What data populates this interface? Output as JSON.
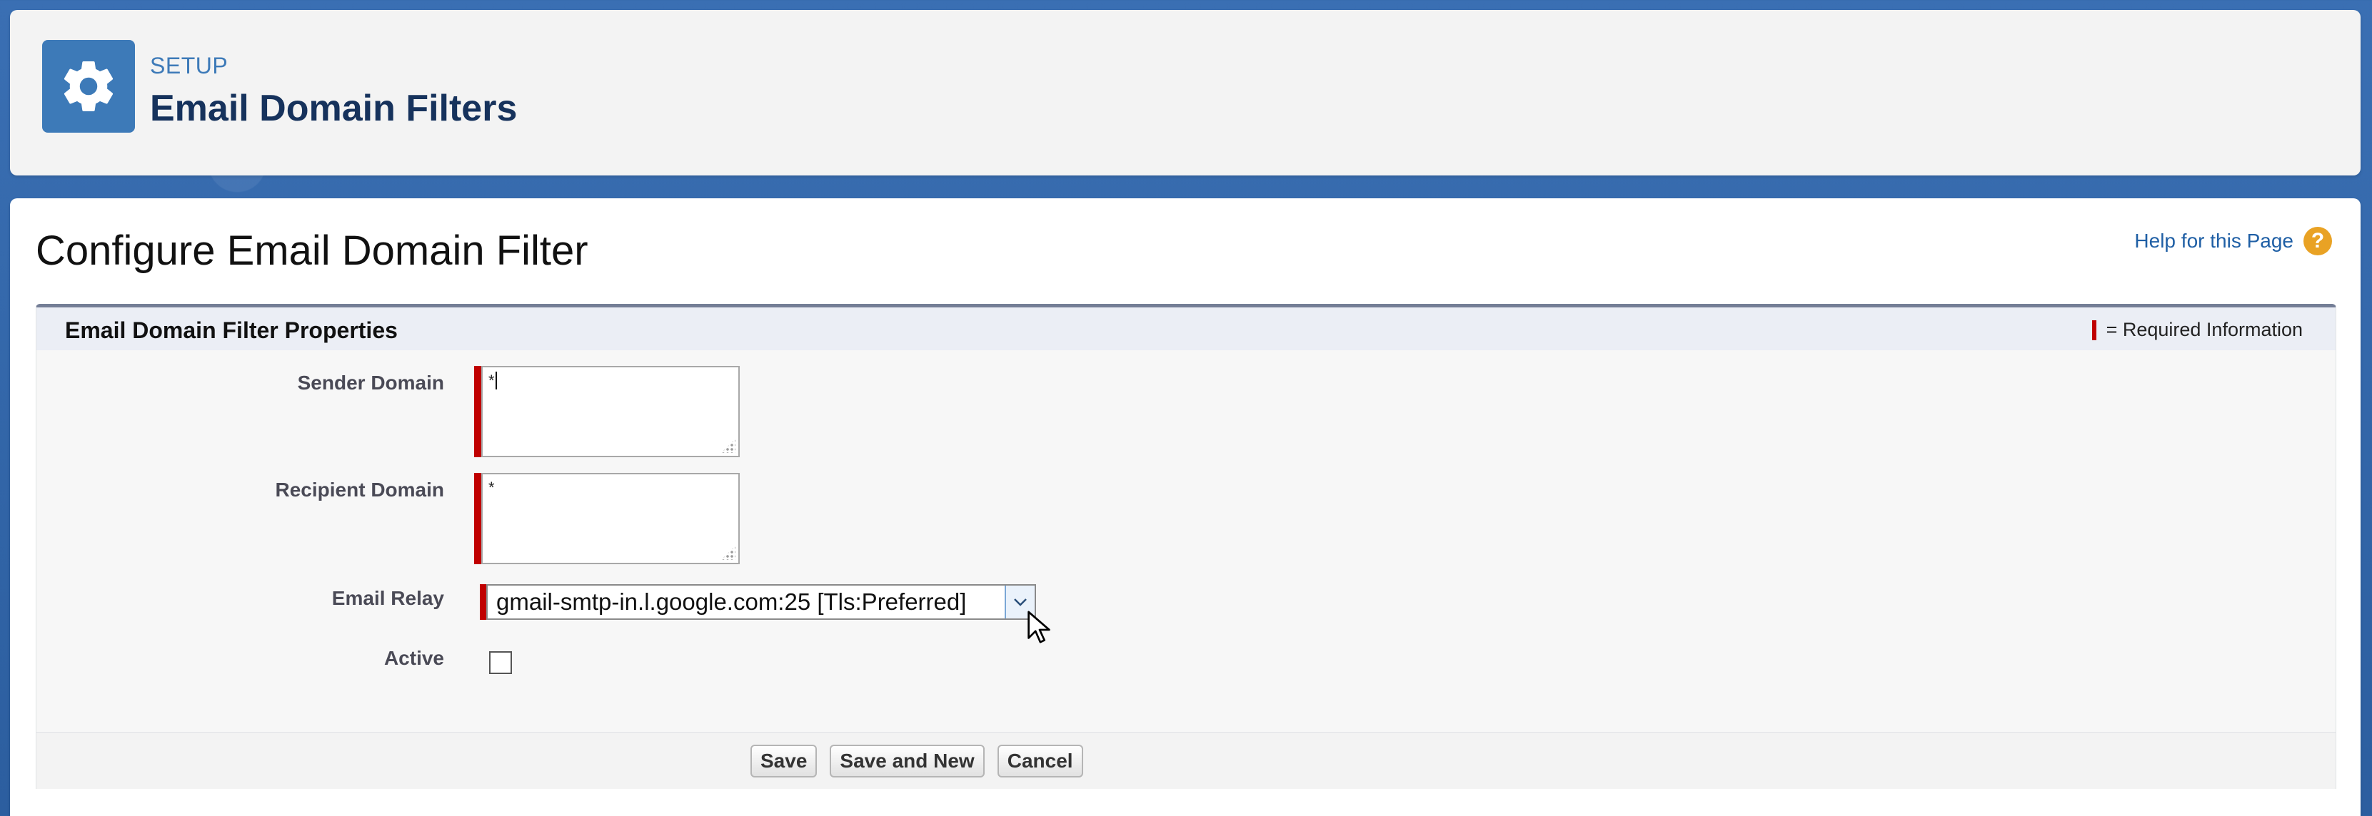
{
  "header": {
    "eyebrow": "SETUP",
    "title": "Email Domain Filters",
    "icon": "gear-icon"
  },
  "page": {
    "title": "Configure Email Domain Filter",
    "help_link": "Help for this Page",
    "help_icon": "question-circle-icon"
  },
  "section": {
    "title": "Email Domain Filter Properties",
    "required_legend": "= Required Information",
    "required_color": "#c00000"
  },
  "fields": {
    "sender_domain": {
      "label": "Sender Domain",
      "value": "*",
      "required": true
    },
    "recipient_domain": {
      "label": "Recipient Domain",
      "value": "*",
      "required": true
    },
    "email_relay": {
      "label": "Email Relay",
      "selected": "gmail-smtp-in.l.google.com:25 [Tls:Preferred]",
      "required": true
    },
    "active": {
      "label": "Active",
      "checked": false
    }
  },
  "buttons": {
    "save": "Save",
    "save_and_new": "Save and New",
    "cancel": "Cancel"
  },
  "colors": {
    "brand_blue": "#3d7ab8",
    "title_navy": "#16325c",
    "link_blue": "#1f5fa5",
    "help_orange": "#e9a224"
  }
}
